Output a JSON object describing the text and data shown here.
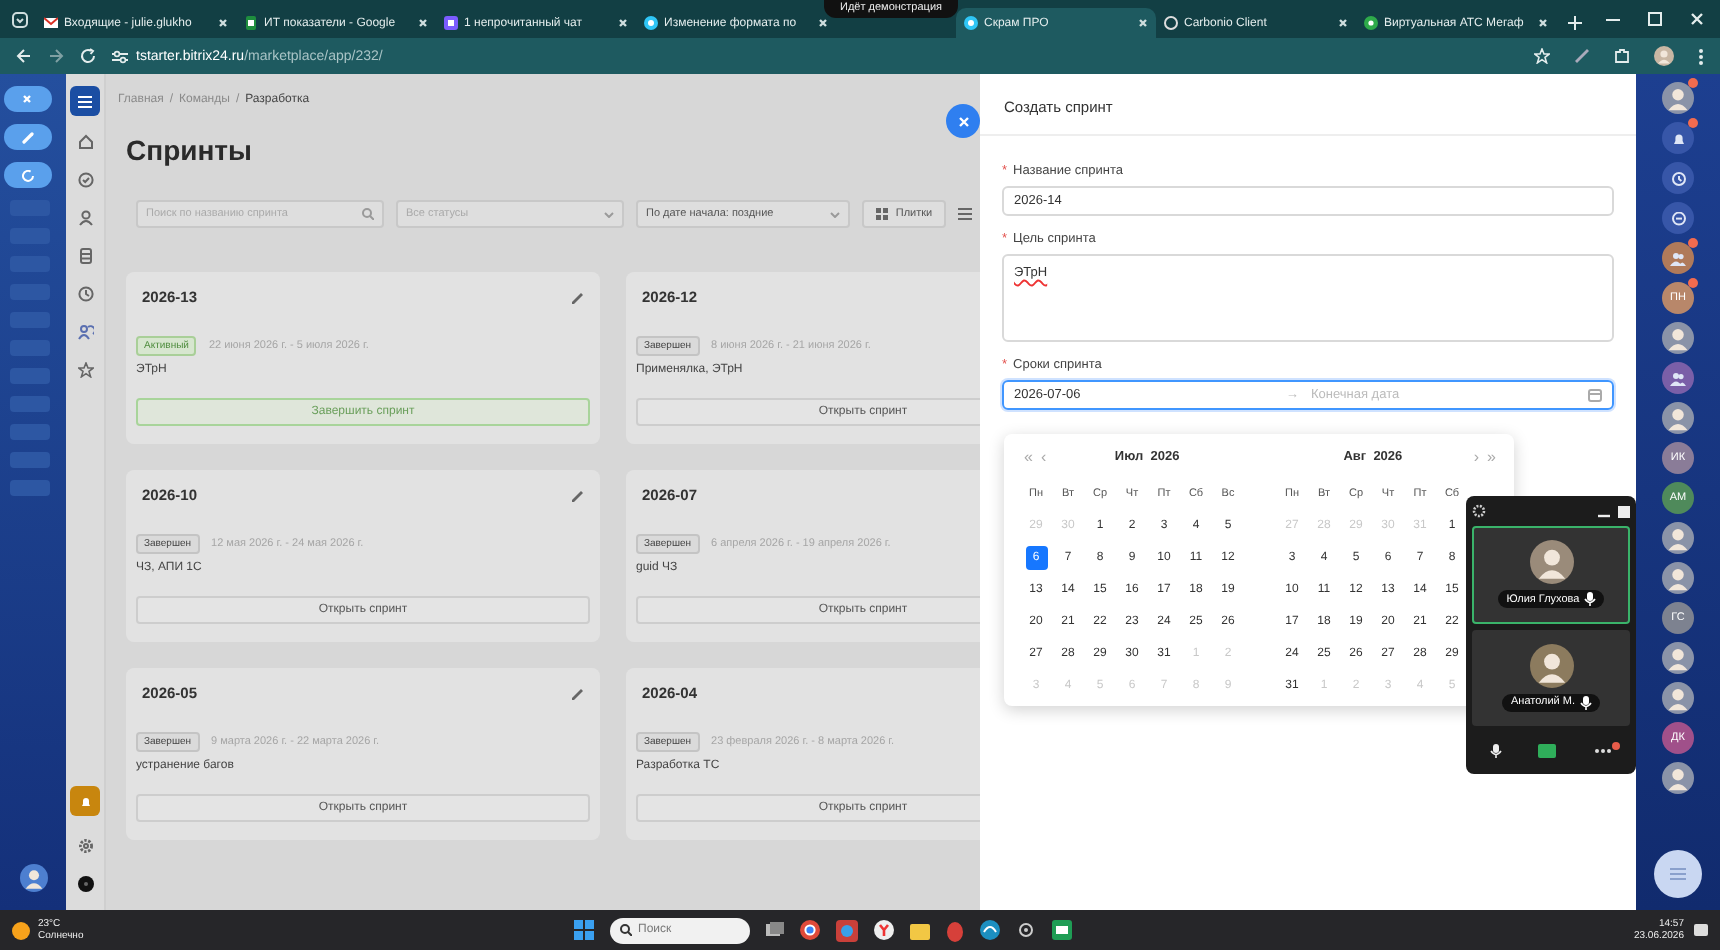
{
  "browser": {
    "tabs": [
      {
        "kind": "mail",
        "label": "Входящие - julie.glukho",
        "selected": false
      },
      {
        "kind": "sheets",
        "label": "ИТ показатели - Google",
        "selected": false
      },
      {
        "kind": "chat",
        "label": "1 непрочитанный чат",
        "selected": false
      },
      {
        "kind": "bitrix",
        "label": "Изменение формата по",
        "selected": false
      },
      {
        "kind": "bitrix",
        "label": "Скрам ПРО",
        "selected": true
      },
      {
        "kind": "carbonio",
        "label": "Carbonio Client",
        "selected": false
      },
      {
        "kind": "phone",
        "label": "Виртуальная АТС Мегаф",
        "selected": false
      }
    ],
    "share_banner": "Идёт демонстрация",
    "url_host": "tstarter.bitrix24.ru",
    "url_path": "/marketplace/app/232/"
  },
  "breadcrumbs": {
    "separator": "/",
    "items": [
      "Главная",
      "Команды",
      "Разработка"
    ]
  },
  "page_title": "Спринты",
  "filters": {
    "search_placeholder": "Поиск по названию спринта",
    "status_placeholder": "Все статусы",
    "sort": "По дате начала: поздние",
    "view_button": "Плитки"
  },
  "sprints": [
    {
      "name": "2026-13",
      "editable": true,
      "status": "Активный",
      "active": true,
      "dates": "22 июня 2026 г. - 5 июля 2026 г.",
      "goal": "ЭТрН",
      "action": "Завершить спринт"
    },
    {
      "name": "2026-12",
      "status": "Завершен",
      "active": false,
      "dates": "8 июня 2026 г. - 21 июня 2026 г.",
      "goal": "Применялка, ЭТрН",
      "action": "Открыть спринт"
    },
    {
      "name": "2026-10",
      "editable": true,
      "status": "Завершен",
      "active": false,
      "dates": "12 мая 2026 г. - 24 мая 2026 г.",
      "goal": "ЧЗ, АПИ 1С",
      "action": "Открыть спринт"
    },
    {
      "name": "2026-07",
      "status": "Завершен",
      "active": false,
      "dates": "6 апреля 2026 г. - 19 апреля 2026 г.",
      "goal": "guid ЧЗ",
      "action": "Открыть спринт"
    },
    {
      "name": "2026-05",
      "editable": true,
      "status": "Завершен",
      "active": false,
      "dates": "9 марта 2026 г. - 22 марта 2026 г.",
      "goal": "устранение багов",
      "action": "Открыть спринт"
    },
    {
      "name": "2026-04",
      "status": "Завершен",
      "active": false,
      "dates": "23 февраля 2026 г. - 8 марта 2026 г.",
      "goal": "Разработка ТС",
      "action": "Открыть спринт"
    }
  ],
  "drawer": {
    "title": "Создать спринт",
    "required_mark": "*",
    "fields": [
      {
        "kind": "text",
        "label": "Название спринта",
        "required": true,
        "value": "2026-14"
      },
      {
        "kind": "textarea",
        "label": "Цель спринта",
        "required": true,
        "value": "ЭТрН"
      },
      {
        "kind": "daterange",
        "label": "Сроки спринта",
        "required": true,
        "value": "2026-07-06",
        "separator": "→",
        "end_placeholder": "Конечная дата",
        "focused": true
      }
    ]
  },
  "calendar": {
    "prev_year": "«",
    "prev_month": "‹",
    "next_month": "›",
    "next_year": "»",
    "months": [
      {
        "title": "Июл  2026",
        "weekdays": [
          "Пн",
          "Вт",
          "Ср",
          "Чт",
          "Пт",
          "Сб",
          "Вс"
        ],
        "weeks": [
          [
            {
              "d": "29",
              "out": true,
              "selected": false
            },
            {
              "d": "30",
              "out": true,
              "selected": false
            },
            {
              "d": "1",
              "out": false,
              "selected": false
            },
            {
              "d": "2",
              "out": false,
              "selected": false
            },
            {
              "d": "3",
              "out": false,
              "selected": false
            },
            {
              "d": "4",
              "out": false,
              "selected": false
            },
            {
              "d": "5",
              "out": false,
              "selected": false
            }
          ],
          [
            {
              "d": "6",
              "out": false,
              "selected": true
            },
            {
              "d": "7",
              "out": false,
              "selected": false
            },
            {
              "d": "8",
              "out": false,
              "selected": false
            },
            {
              "d": "9",
              "out": false,
              "selected": false
            },
            {
              "d": "10",
              "out": false,
              "selected": false
            },
            {
              "d": "11",
              "out": false,
              "selected": false
            },
            {
              "d": "12",
              "out": false,
              "selected": false
            }
          ],
          [
            {
              "d": "13",
              "out": false,
              "selected": false
            },
            {
              "d": "14",
              "out": false,
              "selected": false
            },
            {
              "d": "15",
              "out": false,
              "selected": false
            },
            {
              "d": "16",
              "out": false,
              "selected": false
            },
            {
              "d": "17",
              "out": false,
              "selected": false
            },
            {
              "d": "18",
              "out": false,
              "selected": false
            },
            {
              "d": "19",
              "out": false,
              "selected": false
            }
          ],
          [
            {
              "d": "20",
              "out": false,
              "selected": false
            },
            {
              "d": "21",
              "out": false,
              "selected": false
            },
            {
              "d": "22",
              "out": false,
              "selected": false
            },
            {
              "d": "23",
              "out": false,
              "selected": false
            },
            {
              "d": "24",
              "out": false,
              "selected": false
            },
            {
              "d": "25",
              "out": false,
              "selected": false
            },
            {
              "d": "26",
              "out": false,
              "selected": false
            }
          ],
          [
            {
              "d": "27",
              "out": false,
              "selected": false
            },
            {
              "d": "28",
              "out": false,
              "selected": false
            },
            {
              "d": "29",
              "out": false,
              "selected": false
            },
            {
              "d": "30",
              "out": false,
              "selected": false
            },
            {
              "d": "31",
              "out": false,
              "selected": false
            },
            {
              "d": "1",
              "out": true,
              "selected": false
            },
            {
              "d": "2",
              "out": true,
              "selected": false
            }
          ],
          [
            {
              "d": "3",
              "out": true,
              "selected": false
            },
            {
              "d": "4",
              "out": true,
              "selected": false
            },
            {
              "d": "5",
              "out": true,
              "selected": false
            },
            {
              "d": "6",
              "out": true,
              "selected": false
            },
            {
              "d": "7",
              "out": true,
              "selected": false
            },
            {
              "d": "8",
              "out": true,
              "selected": false
            },
            {
              "d": "9",
              "out": true,
              "selected": false
            }
          ]
        ]
      },
      {
        "title": "Авг  2026",
        "weekdays": [
          "Пн",
          "Вт",
          "Ср",
          "Чт",
          "Пт",
          "Сб"
        ],
        "weeks": [
          [
            {
              "d": "27",
              "out": true,
              "selected": false
            },
            {
              "d": "28",
              "out": true,
              "selected": false
            },
            {
              "d": "29",
              "out": true,
              "selected": false
            },
            {
              "d": "30",
              "out": true,
              "selected": false
            },
            {
              "d": "31",
              "out": true,
              "selected": false
            },
            {
              "d": "1",
              "out": false,
              "selected": false
            }
          ],
          [
            {
              "d": "3",
              "out": false,
              "selected": false
            },
            {
              "d": "4",
              "out": false,
              "selected": false
            },
            {
              "d": "5",
              "out": false,
              "selected": false
            },
            {
              "d": "6",
              "out": false,
              "selected": false
            },
            {
              "d": "7",
              "out": false,
              "selected": false
            },
            {
              "d": "8",
              "out": false,
              "selected": false
            }
          ],
          [
            {
              "d": "10",
              "out": false,
              "selected": false
            },
            {
              "d": "11",
              "out": false,
              "selected": false
            },
            {
              "d": "12",
              "out": false,
              "selected": false
            },
            {
              "d": "13",
              "out": false,
              "selected": false
            },
            {
              "d": "14",
              "out": false,
              "selected": false
            },
            {
              "d": "15",
              "out": false,
              "selected": false
            }
          ],
          [
            {
              "d": "17",
              "out": false,
              "selected": false
            },
            {
              "d": "18",
              "out": false,
              "selected": false
            },
            {
              "d": "19",
              "out": false,
              "selected": false
            },
            {
              "d": "20",
              "out": false,
              "selected": false
            },
            {
              "d": "21",
              "out": false,
              "selected": false
            },
            {
              "d": "22",
              "out": false,
              "selected": false
            }
          ],
          [
            {
              "d": "24",
              "out": false,
              "selected": false
            },
            {
              "d": "25",
              "out": false,
              "selected": false
            },
            {
              "d": "26",
              "out": false,
              "selected": false
            },
            {
              "d": "27",
              "out": false,
              "selected": false
            },
            {
              "d": "28",
              "out": false,
              "selected": false
            },
            {
              "d": "29",
              "out": false,
              "selected": false
            }
          ],
          [
            {
              "d": "31",
              "out": false,
              "selected": false
            },
            {
              "d": "1",
              "out": true,
              "selected": false
            },
            {
              "d": "2",
              "out": true,
              "selected": false
            },
            {
              "d": "3",
              "out": true,
              "selected": false
            },
            {
              "d": "4",
              "out": true,
              "selected": false
            },
            {
              "d": "5",
              "out": true,
              "selected": false
            }
          ]
        ]
      }
    ]
  },
  "video_call": {
    "participants": [
      {
        "name": "Юлия Глухова",
        "speaking": true
      },
      {
        "name": "Анатолий М.",
        "speaking": false
      }
    ],
    "more_alert": true
  },
  "right_rail": [
    {
      "kind": "photo",
      "badge": true
    },
    {
      "kind": "bell",
      "badge": true
    },
    {
      "kind": "clock",
      "badge": false
    },
    {
      "kind": "chat",
      "badge": false
    },
    {
      "kind": "group",
      "badge": true,
      "color": "#b07a5a"
    },
    {
      "kind": "initials",
      "text": "ПН",
      "badge": true,
      "color": "#b8876a"
    },
    {
      "kind": "photo",
      "badge": false
    },
    {
      "kind": "group",
      "badge": false,
      "color": "#7a5fa8"
    },
    {
      "kind": "photo",
      "badge": false
    },
    {
      "kind": "initials",
      "text": "ИК",
      "badge": false,
      "color": "#8a7c98"
    },
    {
      "kind": "initials",
      "text": "АМ",
      "badge": false,
      "color": "#4f8a5b"
    },
    {
      "kind": "photo",
      "badge": false
    },
    {
      "kind": "photo",
      "badge": false
    },
    {
      "kind": "initials",
      "text": "ГС",
      "badge": false,
      "color": "#7d8290"
    },
    {
      "kind": "photo",
      "badge": false
    },
    {
      "kind": "photo",
      "badge": false
    },
    {
      "kind": "initials",
      "text": "ДК",
      "badge": false,
      "color": "#a0508a"
    },
    {
      "kind": "photo",
      "badge": false
    }
  ],
  "taskbar": {
    "temperature": "23°C",
    "weather": "Солнечно",
    "search_placeholder": "Поиск",
    "time": "14:57",
    "date": "23.06.2026"
  }
}
